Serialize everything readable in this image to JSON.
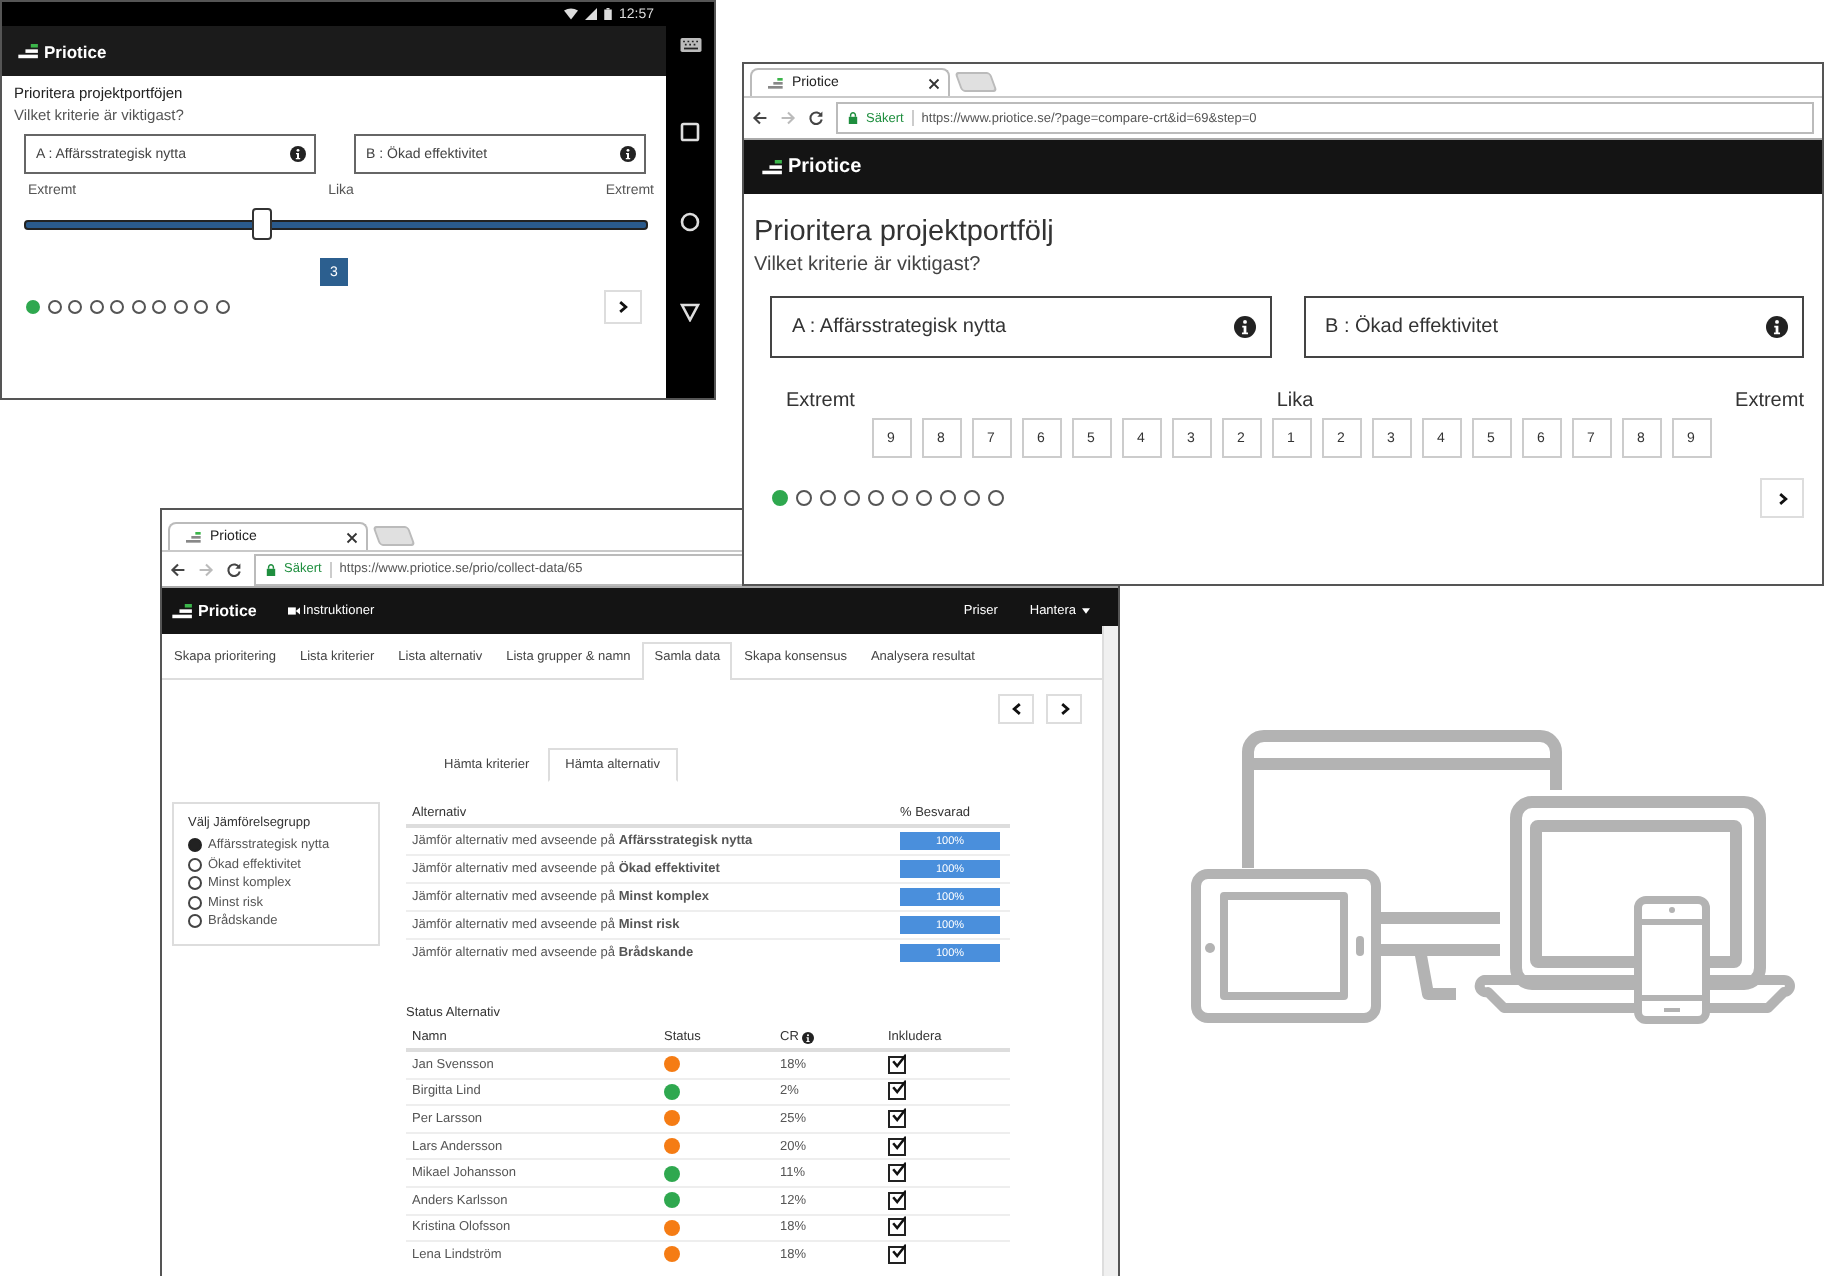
{
  "phone": {
    "time": "12:57",
    "app_name": "Priotice",
    "title": "Prioritera projektportföjen",
    "question": "Vilket kriterie är viktigast?",
    "criteria": [
      {
        "label": "A : Affärsstrategisk nytta"
      },
      {
        "label": "B : Ökad effektivitet"
      }
    ],
    "scale_labels": [
      "Extremt",
      "Lika",
      "Extremt"
    ],
    "slider": {
      "level": 0.38
    },
    "value": "3",
    "steps": [
      {
        "selected": true
      },
      {
        "selected": false
      },
      {
        "selected": false
      },
      {
        "selected": false
      },
      {
        "selected": false
      },
      {
        "selected": false
      },
      {
        "selected": false
      },
      {
        "selected": false
      },
      {
        "selected": false
      },
      {
        "selected": false
      }
    ]
  },
  "compare_browser": {
    "tab_title": "Priotice",
    "security": "Säkert",
    "url": "https://www.priotice.se/?page=compare-crt&id=69&step=0",
    "app_name": "Priotice",
    "title": "Prioritera projektportfölj",
    "question": "Vilket kriterie är viktigast?",
    "criteria": [
      {
        "label": "A : Affärsstrategisk nytta"
      },
      {
        "label": "B : Ökad effektivitet"
      }
    ],
    "scale_labels": [
      "Extremt",
      "Lika",
      "Extremt"
    ],
    "scale": [
      {
        "label": "9",
        "selected": false
      },
      {
        "label": "8",
        "selected": false
      },
      {
        "label": "7",
        "selected": false
      },
      {
        "label": "6",
        "selected": false
      },
      {
        "label": "5",
        "selected": false
      },
      {
        "label": "4",
        "selected": false
      },
      {
        "label": "3",
        "selected": false
      },
      {
        "label": "2",
        "selected": false
      },
      {
        "label": "1",
        "selected": false
      },
      {
        "label": "2",
        "selected": false
      },
      {
        "label": "3",
        "selected": false
      },
      {
        "label": "4",
        "selected": false
      },
      {
        "label": "5",
        "selected": false
      },
      {
        "label": "6",
        "selected": false
      },
      {
        "label": "7",
        "selected": false
      },
      {
        "label": "8",
        "selected": false
      },
      {
        "label": "9",
        "selected": false
      }
    ],
    "steps": [
      {
        "selected": true
      },
      {
        "selected": false
      },
      {
        "selected": false
      },
      {
        "selected": false
      },
      {
        "selected": false
      },
      {
        "selected": false
      },
      {
        "selected": false
      },
      {
        "selected": false
      },
      {
        "selected": false
      },
      {
        "selected": false
      }
    ]
  },
  "collect_browser": {
    "tab_title": "Priotice",
    "security": "Säkert",
    "url": "https://www.priotice.se/prio/collect-data/65",
    "app_name": "Priotice",
    "nav_link": "Instruktioner",
    "menus": [
      {
        "label": "Priser",
        "dropdown": false
      },
      {
        "label": "Hantera",
        "dropdown": true
      }
    ],
    "tabs": [
      {
        "label": "Skapa prioritering",
        "selected": false
      },
      {
        "label": "Lista kriterier",
        "selected": false
      },
      {
        "label": "Lista alternativ",
        "selected": false
      },
      {
        "label": "Lista grupper & namn",
        "selected": false
      },
      {
        "label": "Samla data",
        "selected": true
      },
      {
        "label": "Skapa konsensus",
        "selected": false
      },
      {
        "label": "Analysera resultat",
        "selected": false
      }
    ],
    "subtabs": [
      {
        "label": "Hämta kriterier",
        "selected": false
      },
      {
        "label": "Hämta alternativ",
        "selected": true
      }
    ],
    "group": {
      "title": "Välj Jämförelsegrupp",
      "options": [
        {
          "label": "Affärsstrategisk nytta",
          "selected": true
        },
        {
          "label": "Ökad effektivitet",
          "selected": false
        },
        {
          "label": "Minst komplex",
          "selected": false
        },
        {
          "label": "Minst risk",
          "selected": false
        },
        {
          "label": "Brådskande",
          "selected": false
        }
      ]
    },
    "alternatives": {
      "columns": [
        "Alternativ",
        "% Besvarad"
      ],
      "rows": [
        {
          "text": "Jämför alternativ med avseende på **Affärsstrategisk nytta**",
          "answered": "100%",
          "level": 1
        },
        {
          "text": "Jämför alternativ med avseende på **Ökad effektivitet**",
          "answered": "100%",
          "level": 1
        },
        {
          "text": "Jämför alternativ med avseende på **Minst komplex**",
          "answered": "100%",
          "level": 1
        },
        {
          "text": "Jämför alternativ med avseende på **Minst risk**",
          "answered": "100%",
          "level": 1
        },
        {
          "text": "Jämför alternativ med avseende på **Brådskande**",
          "answered": "100%",
          "level": 1
        }
      ]
    },
    "status": {
      "title": "Status Alternativ",
      "columns": [
        "Namn",
        "Status",
        "CR",
        "Inkludera"
      ],
      "rows": [
        {
          "name": "Jan Svensson",
          "color": "#f57c14",
          "cr": "18%",
          "included": true
        },
        {
          "name": "Birgitta Lind",
          "color": "#2fa84f",
          "cr": "2%",
          "included": true
        },
        {
          "name": "Per Larsson",
          "color": "#f57c14",
          "cr": "25%",
          "included": true
        },
        {
          "name": "Lars Andersson",
          "color": "#f57c14",
          "cr": "20%",
          "included": true
        },
        {
          "name": "Mikael Johansson",
          "color": "#2fa84f",
          "cr": "11%",
          "included": true
        },
        {
          "name": "Anders Karlsson",
          "color": "#2fa84f",
          "cr": "12%",
          "included": true
        },
        {
          "name": "Kristina Olofsson",
          "color": "#f57c14",
          "cr": "18%",
          "included": true
        },
        {
          "name": "Lena Lindström",
          "color": "#f57c14",
          "cr": "18%",
          "included": true
        }
      ]
    }
  }
}
